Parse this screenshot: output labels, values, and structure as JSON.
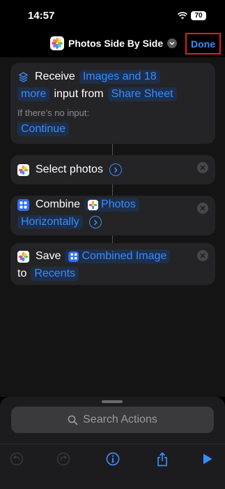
{
  "status_bar": {
    "time": "14:57",
    "battery": "70"
  },
  "nav": {
    "title": "Photos Side By Side",
    "done_label": "Done"
  },
  "actions": {
    "receive": {
      "verb": "Receive",
      "input_types_line1": "Images and 18",
      "input_types_line2": "more",
      "middle": "input from",
      "source": "Share Sheet",
      "no_input_label": "If there’s no input:",
      "no_input_action": "Continue"
    },
    "select_photos": {
      "label": "Select photos"
    },
    "combine": {
      "verb": "Combine",
      "variable": "Photos",
      "direction": "Horizontally"
    },
    "save": {
      "verb": "Save",
      "variable": "Combined Image",
      "to": "to",
      "album": "Recents"
    }
  },
  "search": {
    "placeholder": "Search Actions"
  },
  "colors": {
    "accent": "#3b8cff",
    "done_highlight": "#e02020",
    "combine_icon": "#2f6ef0"
  },
  "icons": [
    "wifi-icon",
    "battery-icon",
    "photos-icon",
    "chevron-down-icon",
    "receive-icon",
    "close-icon",
    "expand-icon",
    "combine-icon",
    "search-icon",
    "undo-icon",
    "redo-icon",
    "info-icon",
    "share-icon",
    "play-icon"
  ]
}
